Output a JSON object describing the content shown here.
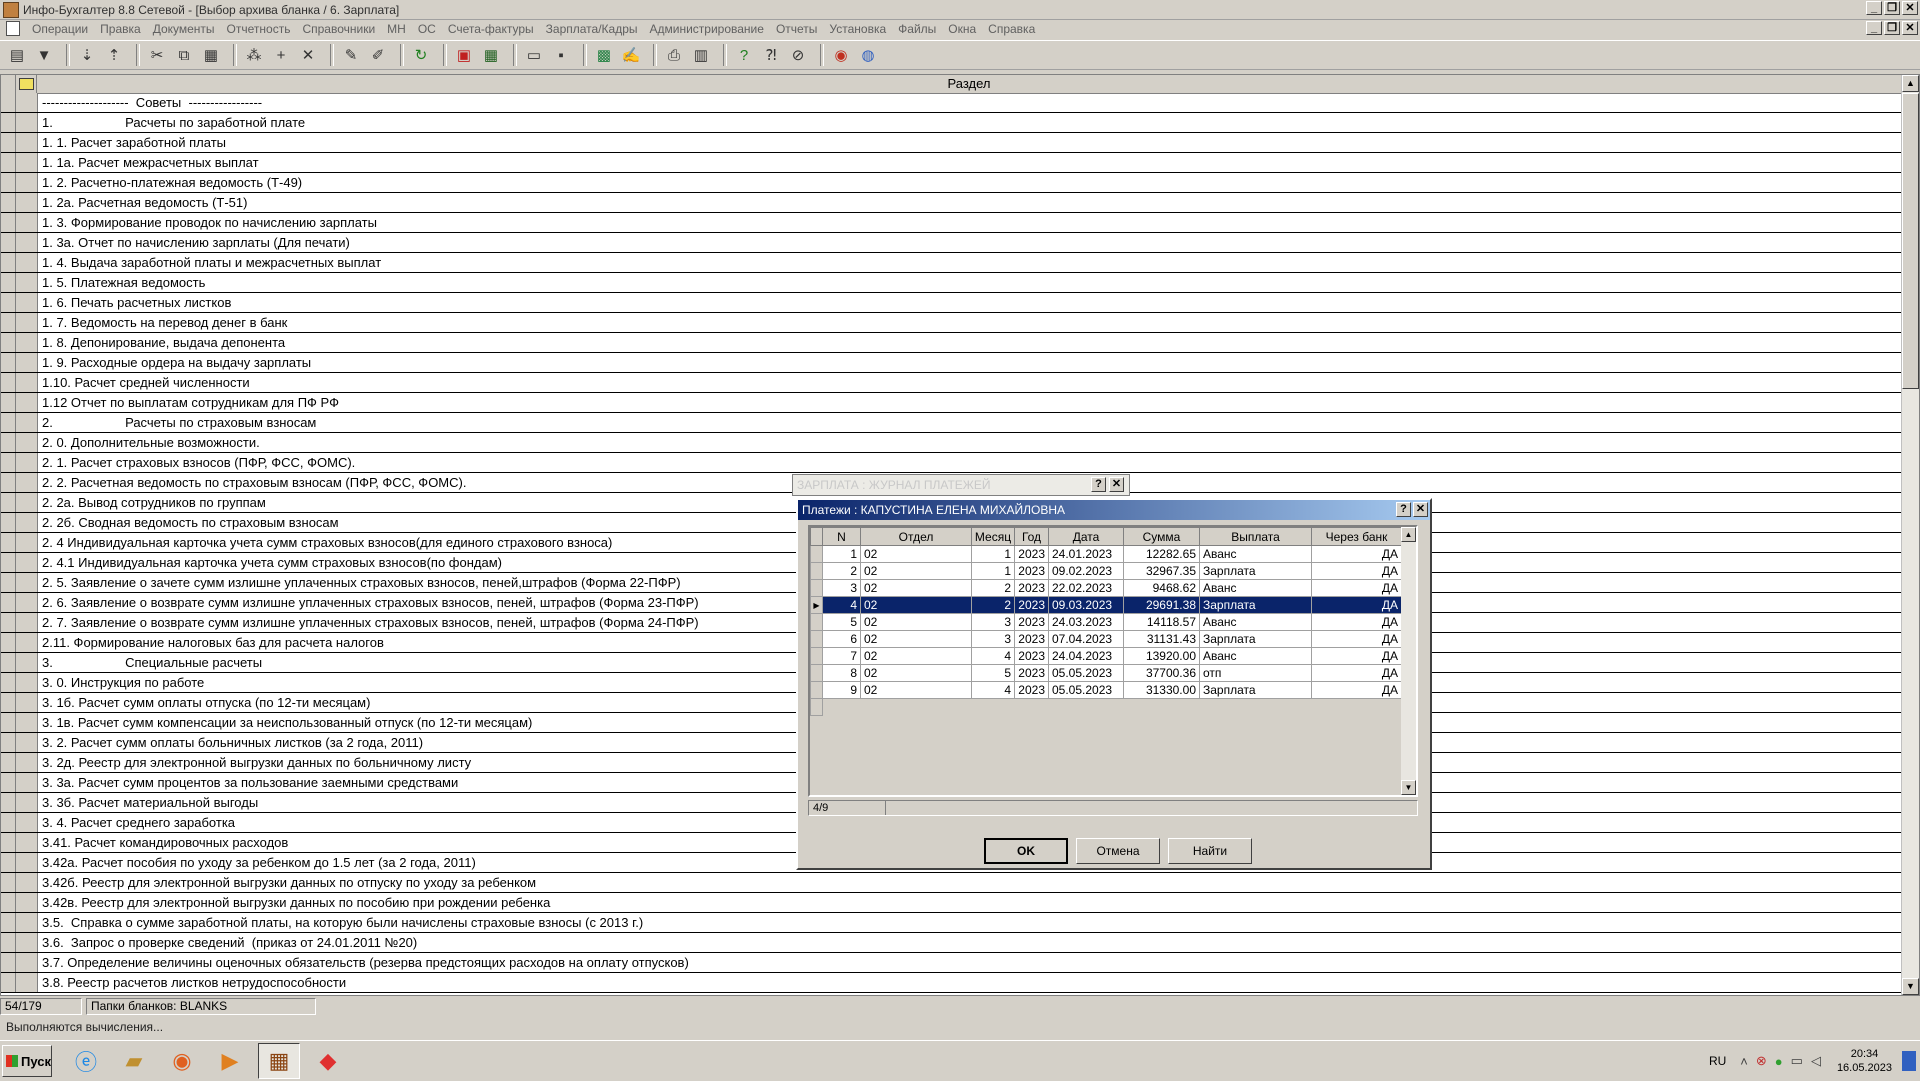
{
  "window": {
    "title": "Инфо-Бухгалтер 8.8 Сетевой - [Выбор архива бланка /      6. Зарплата]"
  },
  "menu": [
    "Операции",
    "Правка",
    "Документы",
    "Отчетность",
    "Справочники",
    "МН",
    "ОС",
    "Счета-фактуры",
    "Зарплата/Кадры",
    "Администрирование",
    "Отчеты",
    "Установка",
    "Файлы",
    "Окна",
    "Справка"
  ],
  "toolbar_icons": [
    "form-icon",
    "filter-icon",
    "sort-asc-icon",
    "sort-desc-icon",
    "cut-icon",
    "copy-icon",
    "paste-icon",
    "group-icon",
    "add-icon",
    "delete-icon",
    "mark-icon",
    "unmark-icon",
    "refresh-icon",
    "pdf-icon",
    "calculator-icon",
    "open-icon",
    "save-icon",
    "excel-icon",
    "word-icon",
    "print-icon",
    "preview-icon",
    "help-icon",
    "context-help-icon",
    "about-icon",
    "support-icon",
    "update-icon"
  ],
  "main": {
    "header": "Раздел",
    "rows": [
      "--------------------  Советы  -----------------",
      "1.                    Расчеты по заработной плате",
      "1. 1. Расчет заработной платы",
      "1. 1а. Расчет межрасчетных выплат",
      "1. 2. Расчетно-платежная ведомость (Т-49)",
      "1. 2а. Расчетная ведомость (Т-51)",
      "1. 3. Формирование проводок по начислению зарплаты",
      "1. 3а. Отчет по начислению зарплаты (Для печати)",
      "1. 4. Выдача заработной платы и межрасчетных выплат",
      "1. 5. Платежная ведомость",
      "1. 6. Печать расчетных листков",
      "1. 7. Ведомость на перевод денег в банк",
      "1. 8. Депонирование, выдача депонента",
      "1. 9. Расходные ордера на выдачу зарплаты",
      "1.10. Расчет средней численности",
      "1.12 Отчет по выплатам сотрудникам для ПФ РФ",
      "2.                    Расчеты по страховым взносам",
      "2. 0. Дополнительные возможности.",
      "2. 1. Расчет страховых взносов (ПФР, ФСС, ФОМС).",
      "2. 2. Расчетная ведомость по страховым взносам (ПФР, ФСС, ФОМС).",
      "2. 2а. Вывод сотрудников по группам",
      "2. 2б. Сводная ведомость по страховым взносам",
      "2. 4 Индивидуальная карточка учета сумм страховых взносов(для единого страхового взноса)",
      "2. 4.1 Индивидуальная карточка учета сумм страховых взносов(по фондам)",
      "2. 5. Заявление о зачете сумм излишне уплаченных страховых взносов, пеней,штрафов (Форма 22-ПФР)",
      "2. 6. Заявление о возврате сумм излишне уплаченных страховых взносов, пеней, штрафов (Форма 23-ПФР)",
      "2. 7. Заявление о возврате сумм излишне уплаченных страховых взносов, пеней, штрафов (Форма 24-ПФР)",
      "2.11. Формирование налоговых баз для расчета налогов",
      "3.                    Специальные расчеты",
      "3. 0. Инструкция по работе",
      "3. 1б. Расчет сумм оплаты отпуска (по 12-ти месяцам)",
      "3. 1в. Расчет сумм компенсации за неиспользованный отпуск (по 12-ти месяцам)",
      "3. 2. Расчет сумм оплаты больничных листков (за 2 года, 2011)",
      "3. 2д. Реестр для электронной выгрузки данных по больничному листу",
      "3. 3а. Расчет сумм процентов за пользование заемными средствами",
      "3. 3б. Расчет материальной выгоды",
      "3. 4. Расчет среднего заработка",
      "3.41. Расчет командировочных расходов",
      "3.42а. Расчет пособия по уходу за ребенком до 1.5 лет (за 2 года, 2011)",
      "3.42б. Реестр для электронной выгрузки данных по отпуску по уходу за ребенком",
      "3.42в. Реестр для электронной выгрузки данных по пособию при рождении ребенка",
      "3.5.  Справка о сумме заработной платы, на которую были начислены страховые взносы (с 2013 г.)",
      "3.6.  Запрос о проверке сведений  (приказ от 24.01.2011 №20)",
      "3.7. Определение величины оценочных обязательств (резерва предстоящих расходов на оплату отпусков)",
      "3.8. Реестр расчетов листков нетрудоспособности"
    ]
  },
  "status": {
    "position": "54/179",
    "folders": "Папки бланков: BLANKS",
    "message": "Выполняются вычисления..."
  },
  "journal_dialog": {
    "title": "ЗАРПЛАТА : ЖУРНАЛ ПЛАТЕЖЕЙ"
  },
  "payments_dialog": {
    "title": "Платежи :  КАПУСТИНА ЕЛЕНА МИХАЙЛОВНА",
    "columns": [
      "N",
      "Отдел",
      "Месяц",
      "Год",
      "Дата",
      "Сумма",
      "Выплата",
      "Через банк"
    ],
    "rows": [
      [
        "1",
        "02",
        "1",
        "2023",
        "24.01.2023",
        "12282.65",
        "Аванс",
        "ДА"
      ],
      [
        "2",
        "02",
        "1",
        "2023",
        "09.02.2023",
        "32967.35",
        "Зарплата",
        "ДА"
      ],
      [
        "3",
        "02",
        "2",
        "2023",
        "22.02.2023",
        "9468.62",
        "Аванс",
        "ДА"
      ],
      [
        "4",
        "02",
        "2",
        "2023",
        "09.03.2023",
        "29691.38",
        "Зарплата",
        "ДА"
      ],
      [
        "5",
        "02",
        "3",
        "2023",
        "24.03.2023",
        "14118.57",
        "Аванс",
        "ДА"
      ],
      [
        "6",
        "02",
        "3",
        "2023",
        "07.04.2023",
        "31131.43",
        "Зарплата",
        "ДА"
      ],
      [
        "7",
        "02",
        "4",
        "2023",
        "24.04.2023",
        "13920.00",
        "Аванс",
        "ДА"
      ],
      [
        "8",
        "02",
        "5",
        "2023",
        "05.05.2023",
        "37700.36",
        "отп",
        "ДА"
      ],
      [
        "9",
        "02",
        "4",
        "2023",
        "05.05.2023",
        "31330.00",
        "Зарплата",
        "ДА"
      ]
    ],
    "selected_index": 3,
    "counter": "4/9",
    "ok_label": "OK",
    "cancel_label": "Отмена",
    "find_label": "Найти"
  },
  "taskbar": {
    "start_label": "Пуск",
    "apps": [
      "ie-icon",
      "explorer-icon",
      "firefox-icon",
      "media-icon",
      "infobuh-icon",
      "anydesk-icon"
    ],
    "lang": "RU",
    "time": "20:34",
    "date": "16.05.2023"
  }
}
